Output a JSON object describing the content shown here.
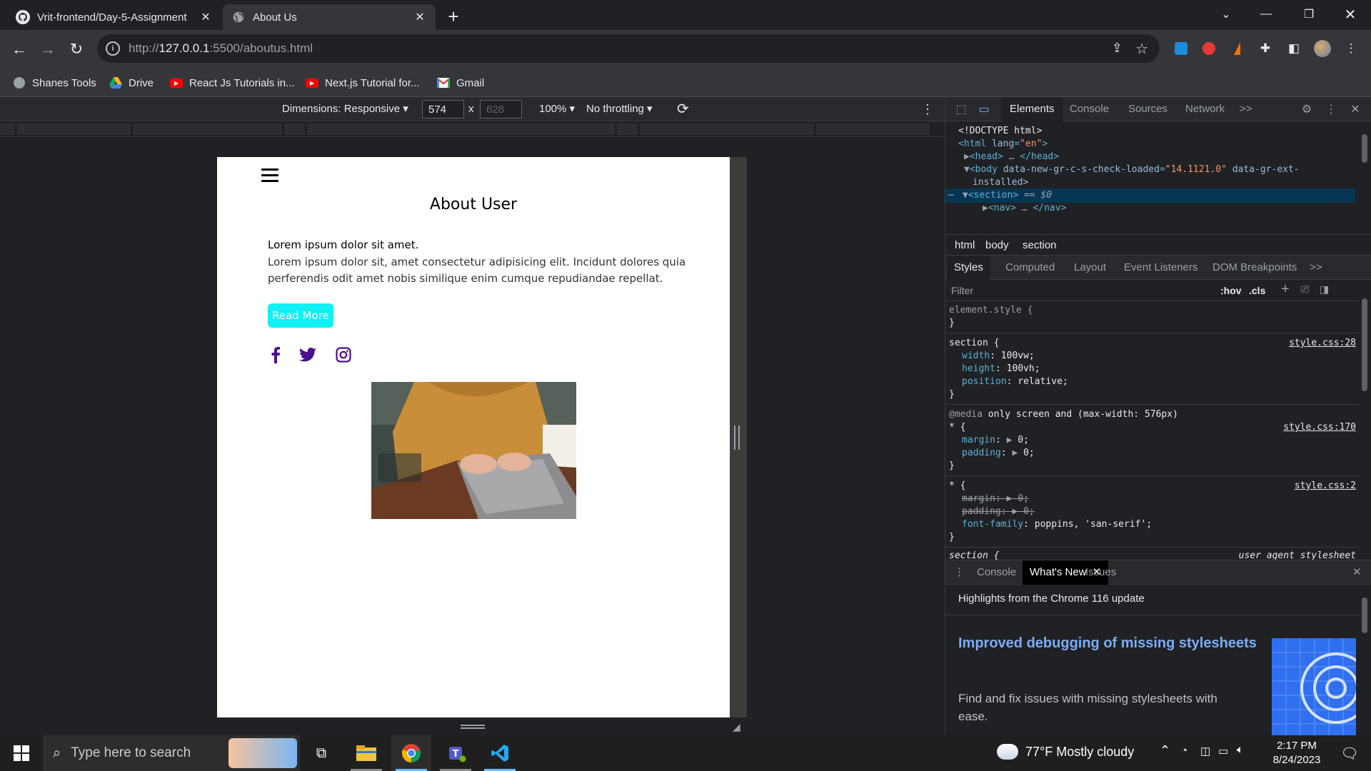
{
  "browser": {
    "tabs": [
      {
        "title": "Vrit-frontend/Day-5-Assignment",
        "favicon": "github-icon",
        "active": false
      },
      {
        "title": "About Us",
        "favicon": "globe-icon",
        "active": true
      }
    ],
    "new_tab_glyph": "+",
    "url": {
      "scheme": "http://",
      "host": "127.0.0.1",
      "rest": ":5500/aboutus.html"
    },
    "bookmarks": [
      {
        "label": "Shanes Tools",
        "icon": "globe-icon"
      },
      {
        "label": "Drive",
        "icon": "drive-icon"
      },
      {
        "label": "React Js Tutorials in...",
        "icon": "youtube-icon"
      },
      {
        "label": "Next.js Tutorial for...",
        "icon": "youtube-icon"
      },
      {
        "label": "Gmail",
        "icon": "gmail-icon"
      }
    ]
  },
  "device_toolbar": {
    "dimensions_label": "Dimensions: Responsive",
    "width": "574",
    "height": "628",
    "times": "x",
    "zoom": "100%",
    "throttling": "No throttling"
  },
  "page": {
    "title": "About User",
    "lead": "Lorem ipsum dolor sit amet.",
    "paragraph": "Lorem ipsum dolor sit, amet consectetur adipisicing elit. Incidunt dolores quia perferendis odit amet nobis similique enim cumque repudiandae repellat.",
    "button": "Read More",
    "button_color": "#10f1f5",
    "social_color": "#4b0f8c",
    "social": [
      "facebook-icon",
      "twitter-icon",
      "instagram-icon"
    ]
  },
  "devtools": {
    "tabs": [
      "Elements",
      "Console",
      "Sources",
      "Network",
      ">>"
    ],
    "dom": {
      "doctype": "<!DOCTYPE html>",
      "html_open": "<html",
      "html_attr": "lang",
      "html_val": "\"en\"",
      "head": "<head>",
      "head_close": "</head>",
      "body_open": "<body",
      "body_attr1": "data-new-gr-c-s-check-loaded",
      "body_val1": "\"14.1121.0\"",
      "body_attr2": "data-gr-ext-",
      "body_line2": "installed>",
      "section": "<section>",
      "section_ref": "== $0",
      "nav": "<nav>",
      "nav_close": "</nav>",
      "ellipsis": "…"
    },
    "breadcrumb": [
      "html",
      "body",
      "section"
    ],
    "subtabs": [
      "Styles",
      "Computed",
      "Layout",
      "Event Listeners",
      "DOM Breakpoints",
      ">>"
    ],
    "filter_placeholder": "Filter",
    "hov": ":hov",
    "cls": ".cls",
    "styles": {
      "element_style": "element.style {",
      "close": "}",
      "section_sel": "section {",
      "section_link": "style.css:28",
      "width_prop": "width",
      "width_val": "100vw;",
      "height_prop": "height",
      "height_val": "100vh;",
      "position_prop": "position",
      "position_val": "relative;",
      "media_at": "@media",
      "media_rest": "only screen and (max-width: 576px)",
      "star_sel": "* {",
      "star_link1": "style.css:170",
      "margin_prop": "margin",
      "padding_prop": "padding",
      "zero": "0;",
      "star_link2": "style.css:2",
      "font_prop": "font-family",
      "font_val": "poppins, 'san-serif';",
      "next_sel": "section {",
      "next_link": "user agent stylesheet"
    },
    "drawer": {
      "tabs": [
        "Console",
        "What's New",
        "Issues"
      ],
      "highlights": "Highlights from the Chrome 116 update",
      "headline": "Improved debugging of missing stylesheets",
      "desc": "Find and fix issues with missing stylesheets with ease."
    }
  },
  "taskbar": {
    "search_placeholder": "Type here to search",
    "weather": "77°F  Mostly cloudy",
    "time": "2:17 PM",
    "date": "8/24/2023"
  }
}
